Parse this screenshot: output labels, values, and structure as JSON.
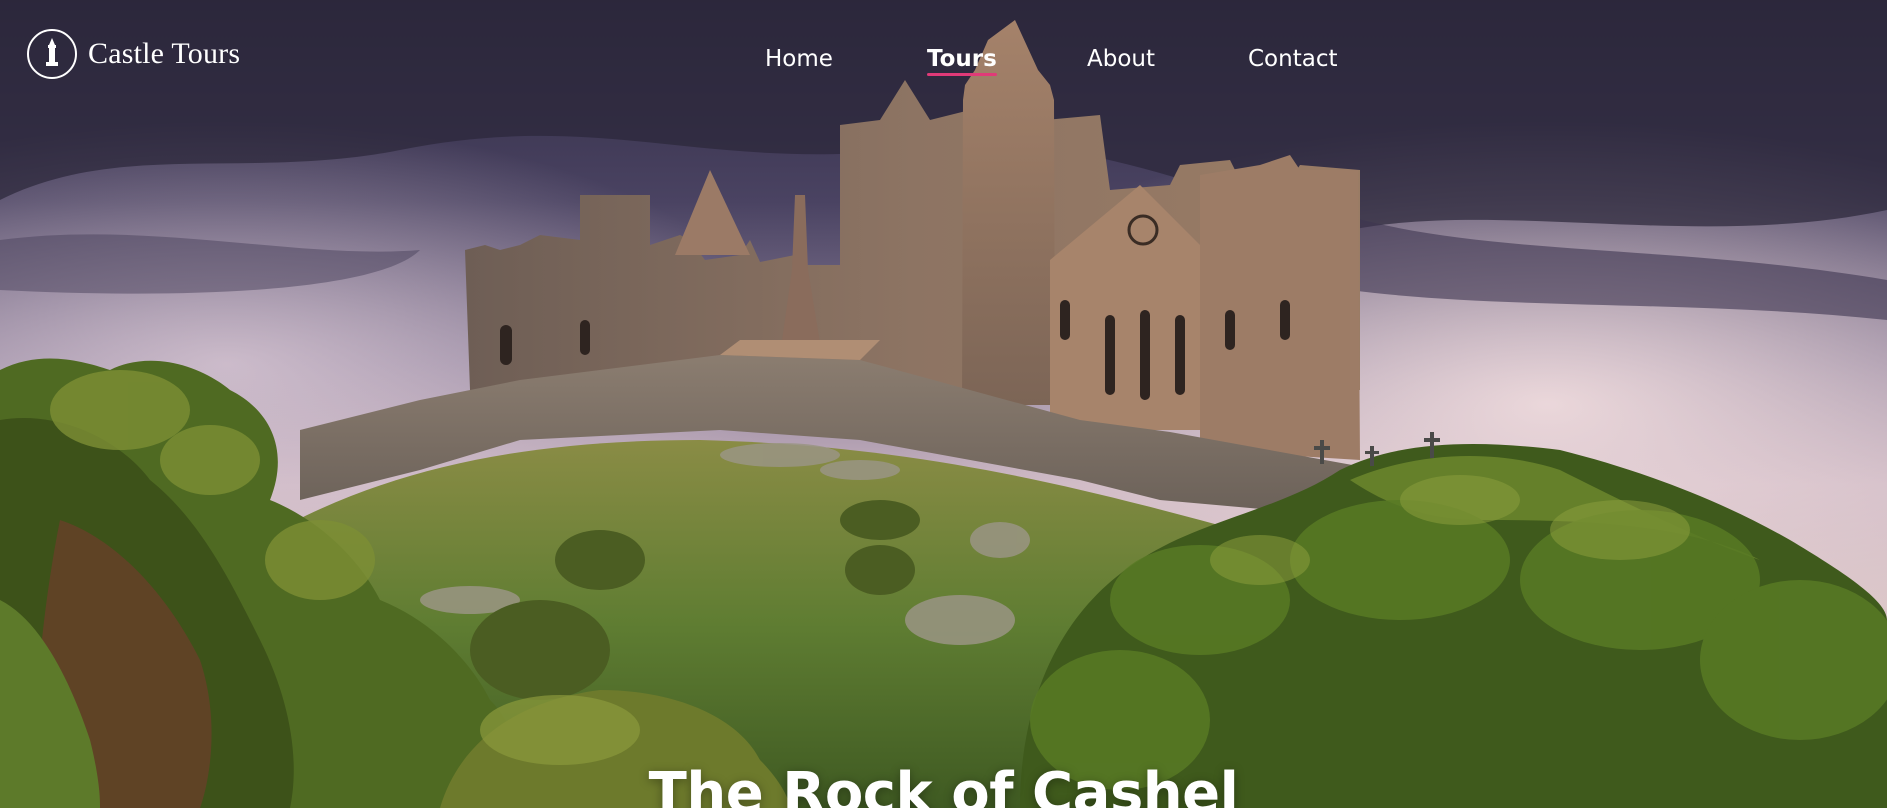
{
  "brand": {
    "name": "Castle Tours",
    "logo_icon": "castle-tower-icon"
  },
  "nav": {
    "items": [
      {
        "label": "Home",
        "active": false
      },
      {
        "label": "Tours",
        "active": true
      },
      {
        "label": "About",
        "active": false
      },
      {
        "label": "Contact",
        "active": false
      }
    ],
    "active_underline_color": "#e03a78"
  },
  "hero": {
    "title": "The Rock of Cashel",
    "image_subject": "castle-on-hill-photo"
  }
}
